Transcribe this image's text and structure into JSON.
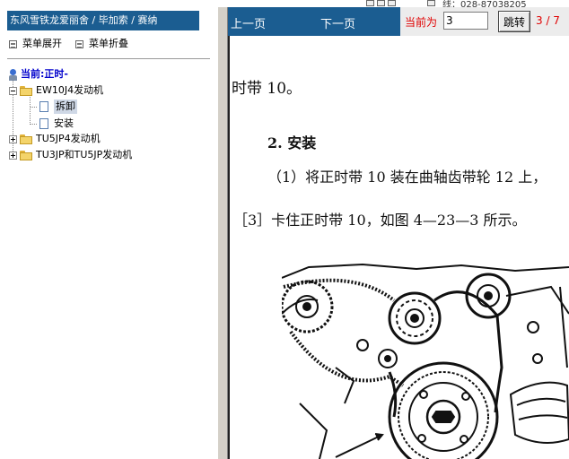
{
  "top": {
    "fragment": "线：028-87038205"
  },
  "left": {
    "title": "东风雪铁龙爱丽舍 / 毕加索 / 赛纳",
    "menu": {
      "expand": "菜单展开",
      "collapse": "菜单折叠"
    },
    "tree": {
      "current": "当前:正时-",
      "n1": "EW10J4发动机",
      "n1a": "拆卸",
      "n1b": "安装",
      "n2": "TU5JP4发动机",
      "n3": "TU3JP和TU5JP发动机"
    }
  },
  "nav": {
    "prev": "上一页",
    "next": "下一页",
    "current_label": "当前为",
    "page_value": "3",
    "jump": "跳转",
    "count": "3 / 7"
  },
  "doc": {
    "line1": "时带 10。",
    "heading": "2. 安装",
    "step1": "（1）将正时带 10 装在曲轴齿带轮 12 上，",
    "step3": "［3］卡住正时带 10，如图 4—23—3 所示。"
  },
  "colors": {
    "header_blue": "#1b5d91",
    "accent_red": "#e00000"
  }
}
